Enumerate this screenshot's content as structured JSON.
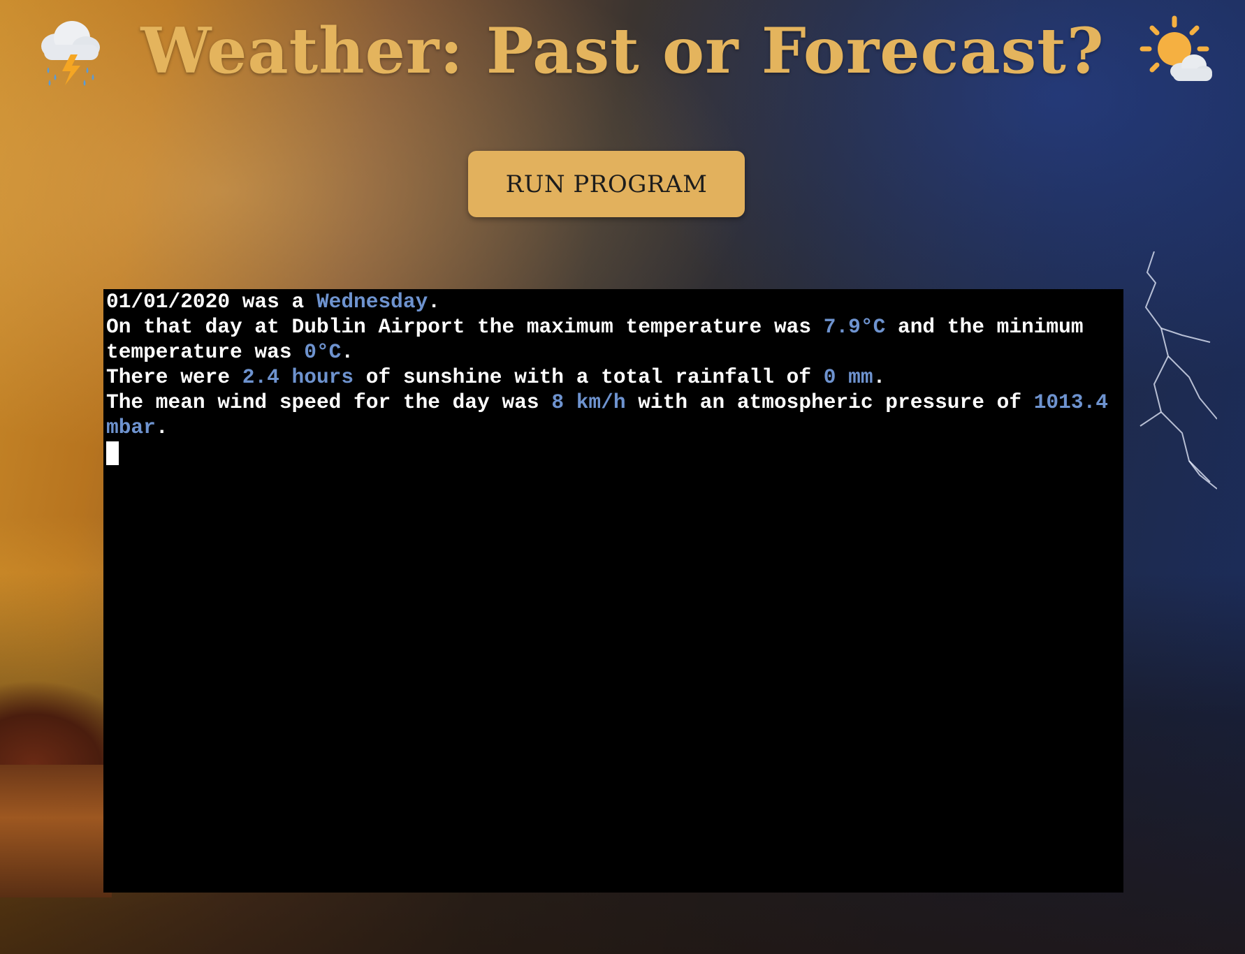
{
  "header": {
    "title": "Weather: Past or Forecast?",
    "left_icon": "thunderstorm-cloud-icon",
    "right_icon": "sun-behind-cloud-icon"
  },
  "controls": {
    "run_label": "RUN PROGRAM"
  },
  "terminal": {
    "line1": {
      "a": "01/01/2020 was a ",
      "b": "Wednesday",
      "c": "."
    },
    "line2": {
      "a": "On that day at Dublin Airport the maximum temperature was ",
      "b": "7.9°C",
      "c": " and the minimum temperature was ",
      "d": "0°C",
      "e": "."
    },
    "line3": {
      "a": "There were ",
      "b": "2.4 hours",
      "c": " of sunshine with a total rainfall of ",
      "d": "0 mm",
      "e": "."
    },
    "line4": {
      "a": "The mean wind speed for the day was ",
      "b": "8 km/h",
      "c": " with an atmospheric pressure of ",
      "d": "1013.4 mbar",
      "e": "."
    }
  },
  "colors": {
    "accent": "#e4b45d",
    "button_bg": "#e2b15d",
    "terminal_bg": "#000000",
    "terminal_text": "#ffffff",
    "terminal_highlight": "#6e93cf"
  }
}
